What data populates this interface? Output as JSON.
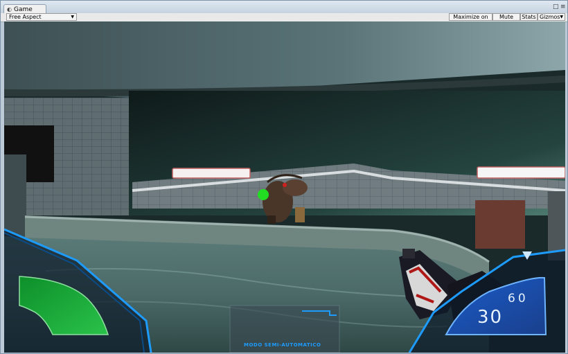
{
  "tab": {
    "title": "Game"
  },
  "toolbar": {
    "aspect": "Free Aspect",
    "maximize": "Maximize on Play",
    "mute": "Mute audio",
    "stats": "Stats",
    "gizmos": "Gizmos"
  },
  "hud": {
    "ammo_clip": "30",
    "ammo_reserve": "60",
    "fire_mode": "MODO SEMI-AUTOMATICO",
    "health_fraction": 1.0
  },
  "colors": {
    "hud_blue": "#1e9bff",
    "health_green": "#1ea838",
    "crosshair_green": "#22dd22"
  }
}
